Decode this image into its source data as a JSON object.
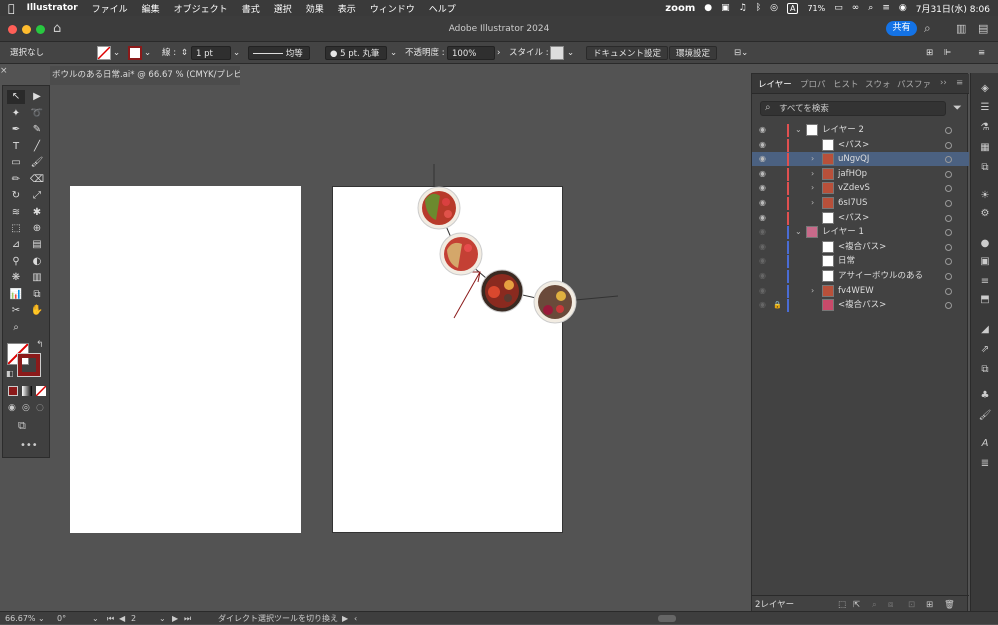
{
  "menubar": {
    "apple": "",
    "app_name": "Illustrator",
    "items": [
      "ファイル",
      "編集",
      "オブジェクト",
      "書式",
      "選択",
      "効果",
      "表示",
      "ウィンドウ",
      "ヘルプ"
    ],
    "zoom": "zoom",
    "battery": "71%",
    "input_method": "A",
    "datetime": "7月31日(水) 8:06"
  },
  "window": {
    "title": "Adobe Illustrator 2024",
    "share_label": "共有"
  },
  "control_bar": {
    "selection": "選択なし",
    "stroke_label": "線 :",
    "stroke_value": "1 pt",
    "stroke_profile": "均等",
    "brush": "5 pt. 丸筆",
    "opacity_label": "不透明度 :",
    "opacity_value": "100%",
    "style_label": "スタイル :",
    "doc_setup": "ドキュメント設定",
    "preferences": "環境設定"
  },
  "document_tab": {
    "title": "ボウルのある日常.ai* @ 66.67 % (CMYK/プレビュー)"
  },
  "layers_panel": {
    "tabs": [
      "レイヤー",
      "プロパ",
      "ヒスト",
      "スウォ",
      "パスファ"
    ],
    "search_placeholder": "すべてを検索",
    "rows": [
      {
        "name": "レイヤー 2",
        "color": "#e05050",
        "level": 0,
        "expanded": true,
        "selected": false,
        "visible": true,
        "locked": false
      },
      {
        "name": "<パス>",
        "color": "#e05050",
        "level": 1,
        "selected": false,
        "visible": true,
        "locked": false
      },
      {
        "name": "uNgvQJ",
        "color": "#e05050",
        "level": 1,
        "selected": true,
        "visible": true,
        "locked": false
      },
      {
        "name": "jafHOp",
        "color": "#e05050",
        "level": 1,
        "selected": false,
        "visible": true,
        "locked": false
      },
      {
        "name": "vZdevS",
        "color": "#e05050",
        "level": 1,
        "selected": false,
        "visible": true,
        "locked": false
      },
      {
        "name": "6sI7US",
        "color": "#e05050",
        "level": 1,
        "selected": false,
        "visible": true,
        "locked": false
      },
      {
        "name": "<パス>",
        "color": "#e05050",
        "level": 1,
        "selected": false,
        "visible": true,
        "locked": false
      },
      {
        "name": "レイヤー 1",
        "color": "#4a6cd4",
        "level": 0,
        "expanded": true,
        "selected": false,
        "visible": false,
        "locked": false
      },
      {
        "name": "<複合パス>",
        "color": "#4a6cd4",
        "level": 1,
        "selected": false,
        "visible": false,
        "locked": false
      },
      {
        "name": "日常",
        "color": "#4a6cd4",
        "level": 1,
        "selected": false,
        "visible": false,
        "locked": false
      },
      {
        "name": "アサイーボウルのある",
        "color": "#4a6cd4",
        "level": 1,
        "selected": false,
        "visible": false,
        "locked": false
      },
      {
        "name": "fv4WEW",
        "color": "#4a6cd4",
        "level": 1,
        "selected": false,
        "visible": false,
        "locked": false
      },
      {
        "name": "<複合パス>",
        "color": "#4a6cd4",
        "level": 1,
        "selected": false,
        "visible": false,
        "locked": true
      }
    ],
    "footer": "2レイヤー"
  },
  "status_bar": {
    "zoom": "66.67%",
    "rotation": "0°",
    "page": "2",
    "tool_hint": "ダイレクト選択ツールを切り換え"
  },
  "colors": {
    "accent": "#1473e6",
    "layer2": "#e05050",
    "layer1": "#4a6cd4",
    "selected_row": "#4b6181"
  }
}
